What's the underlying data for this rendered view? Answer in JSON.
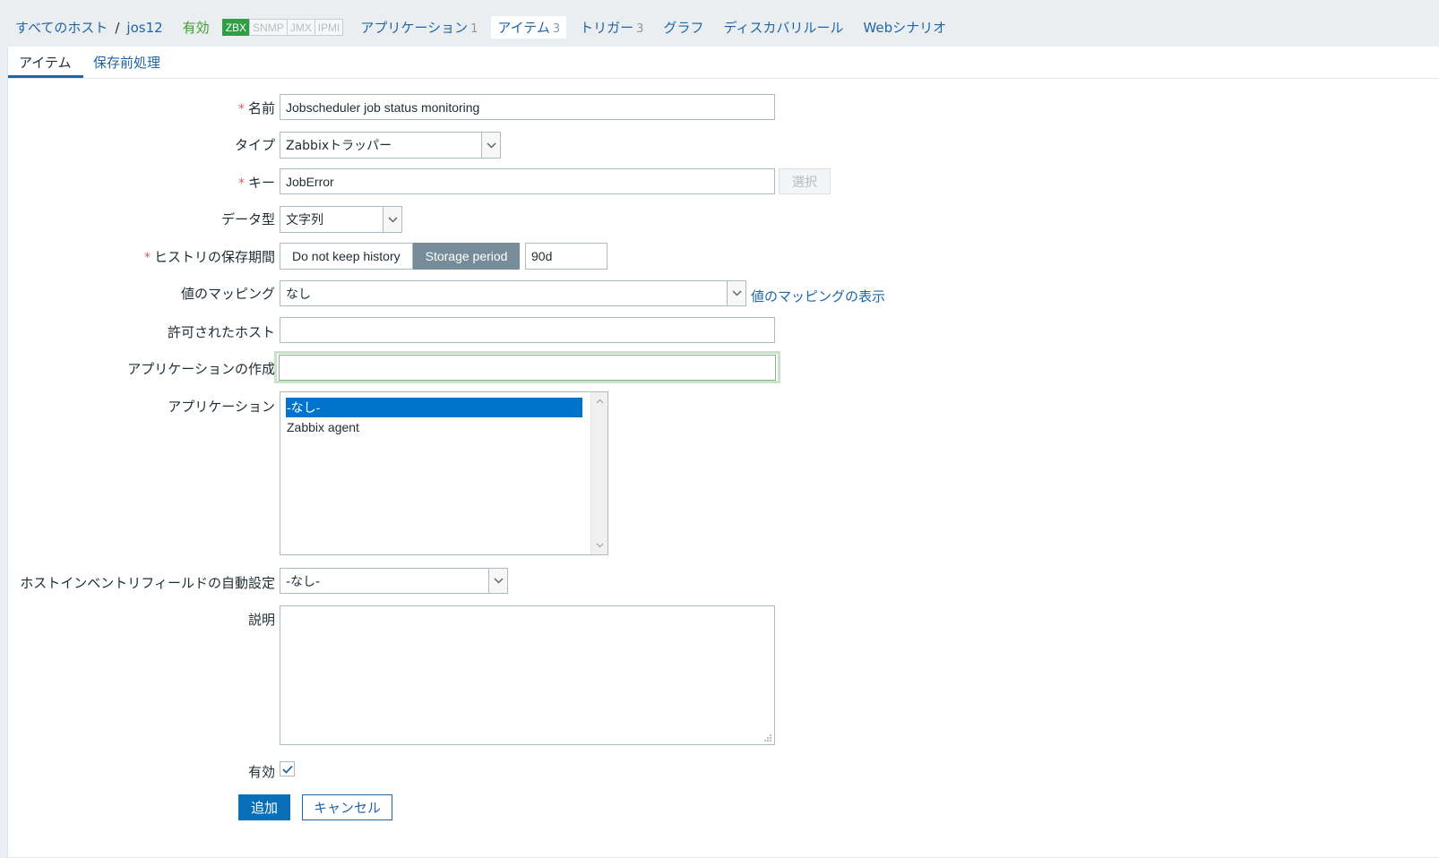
{
  "breadcrumb": {
    "all_hosts": "すべてのホスト",
    "separator": "/",
    "host": "jos12",
    "status": "有効"
  },
  "availability": [
    "ZBX",
    "SNMP",
    "JMX",
    "IPMI"
  ],
  "host_nav": [
    {
      "label": "アプリケーション",
      "count": "1"
    },
    {
      "label": "アイテム",
      "count": "3"
    },
    {
      "label": "トリガー",
      "count": "3"
    },
    {
      "label": "グラフ",
      "count": ""
    },
    {
      "label": "ディスカバリルール",
      "count": ""
    },
    {
      "label": "Webシナリオ",
      "count": ""
    }
  ],
  "tabs": {
    "item": "アイテム",
    "preprocessing": "保存前処理"
  },
  "form": {
    "required_mark": "*",
    "name_label": "名前",
    "name_value": "Jobscheduler job status monitoring",
    "type_label": "タイプ",
    "type_value": "Zabbixトラッパー",
    "key_label": "キー",
    "key_value": "JobError",
    "select_button": "選択",
    "datatype_label": "データ型",
    "datatype_value": "文字列",
    "history_label": "ヒストリの保存期間",
    "history_opt1": "Do not keep history",
    "history_opt2": "Storage period",
    "history_value": "90d",
    "valuemap_label": "値のマッピング",
    "valuemap_value": "なし",
    "valuemap_link": "値のマッピングの表示",
    "allowed_hosts_label": "許可されたホスト",
    "allowed_hosts_value": "",
    "new_app_label": "アプリケーションの作成",
    "new_app_value": "",
    "apps_label": "アプリケーション",
    "apps_options": [
      "-なし-",
      "Zabbix agent"
    ],
    "inventory_label": "ホストインベントリフィールドの自動設定",
    "inventory_value": "-なし-",
    "description_label": "説明",
    "enabled_label": "有効",
    "add_button": "追加",
    "cancel_button": "キャンセル"
  },
  "colors": {
    "link": "#1f65a8",
    "enabled": "#3a9b2e",
    "primary": "#0a6fb9",
    "selected": "#0074cc",
    "required": "#e45959"
  }
}
